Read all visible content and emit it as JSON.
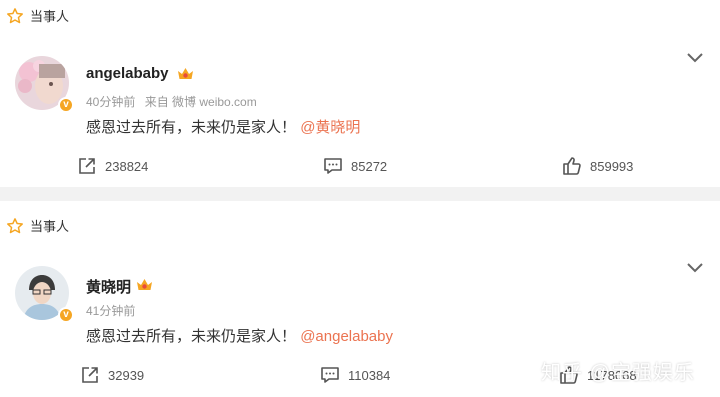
{
  "posts": [
    {
      "header_label": "当事人",
      "username": "angelababy",
      "time": "40分钟前",
      "source": "来自 微博 weibo.com",
      "text": "感恩过去所有，未来仍是家人！",
      "mention": "@黄晓明",
      "reposts": "238824",
      "comments": "85272",
      "likes": "859993"
    },
    {
      "header_label": "当事人",
      "username": "黄晓明",
      "time": "41分钟前",
      "text": "感恩过去所有，未来仍是家人！",
      "mention": "@angelababy",
      "reposts": "32939",
      "comments": "110384",
      "likes": "1178068"
    }
  ],
  "watermark": "知乎 @宝强娱乐",
  "colors": {
    "accent": "#eb7350",
    "star": "#f5a623",
    "verified": "#f5a623"
  },
  "icons": [
    "star-icon",
    "chevron-down-icon",
    "crown-icon",
    "verified-badge",
    "repost-icon",
    "comment-icon",
    "like-icon"
  ]
}
